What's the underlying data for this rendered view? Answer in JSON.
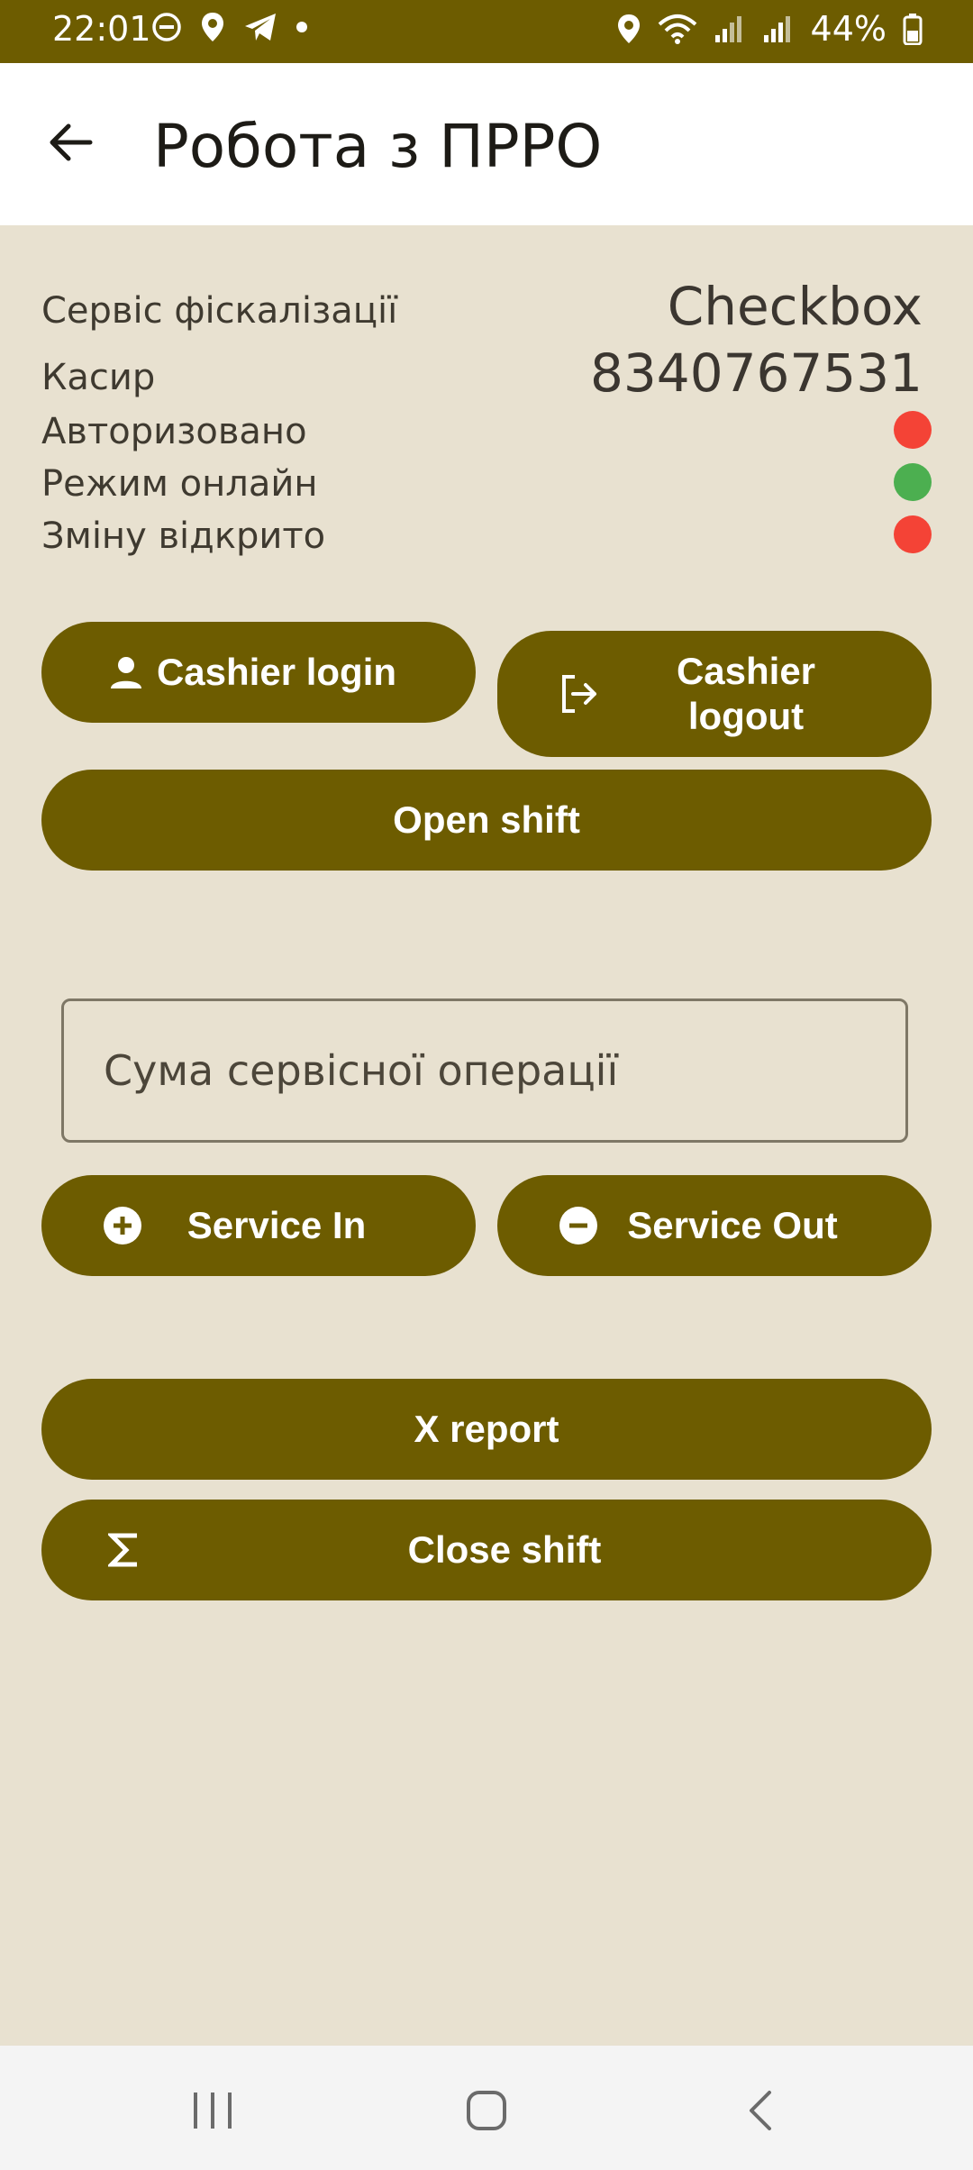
{
  "status_bar": {
    "time": "22:01",
    "battery": "44%",
    "icons_left": [
      "do-not-disturb-icon",
      "location-icon",
      "telegram-icon",
      "dot-icon"
    ],
    "icons_right": [
      "location-icon",
      "wifi-icon",
      "signal-roaming-icon",
      "signal-icon",
      "battery-icon"
    ]
  },
  "appbar": {
    "title": "Робота з ПРРО",
    "back_icon": "arrow-left-icon"
  },
  "info": {
    "service_label": "Сервіс фіскалізації",
    "service_value": "Checkbox",
    "cashier_label": "Касир",
    "cashier_value": "8340767531",
    "authorized_label": "Авторизовано",
    "online_label": "Режим онлайн",
    "shift_label": "Зміну відкрито"
  },
  "status_colors": {
    "authorized": "#f44336",
    "online": "#4caf50",
    "shift": "#f44336"
  },
  "buttons": {
    "cashier_login": "Cashier login",
    "cashier_logout": "Cashier logout",
    "open_shift": "Open shift",
    "service_in": "Service In",
    "service_out": "Service Out",
    "x_report": "X report",
    "close_shift": "Close shift"
  },
  "amount_input": {
    "placeholder": "Сума сервісної операції",
    "value": ""
  },
  "colors": {
    "primary": "#6d5c00",
    "background": "#e8e1d0"
  }
}
